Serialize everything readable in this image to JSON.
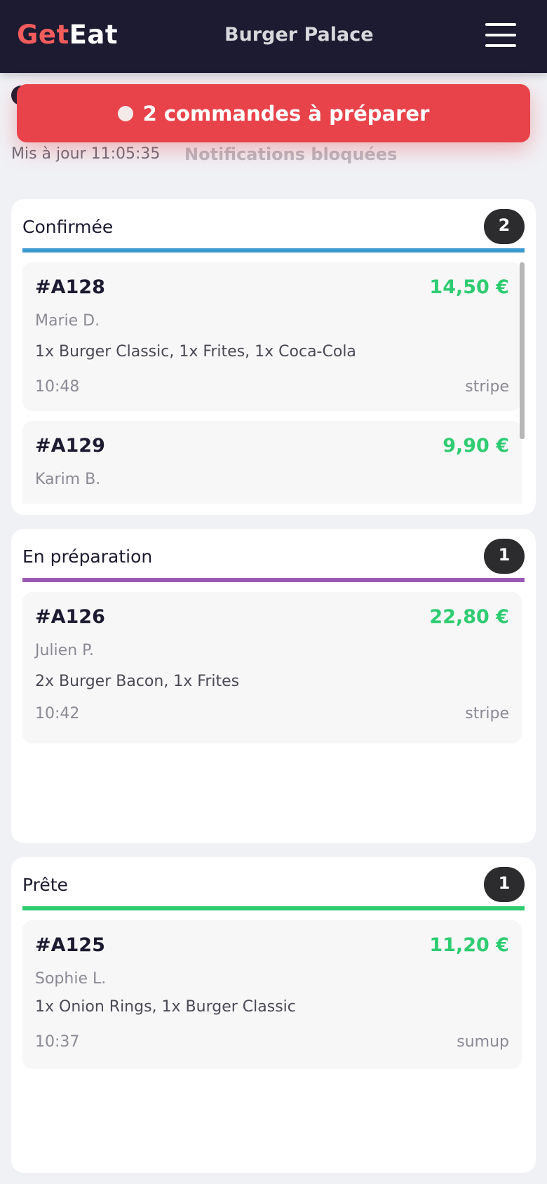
{
  "header": {
    "logo_part1": "Get",
    "logo_part2": "Eat",
    "restaurant": "Burger Palace",
    "menu_icon": "hamburger-menu-icon"
  },
  "alert": {
    "text": "2 commandes à préparer"
  },
  "status": {
    "updated": "Mis à jour 11:05:35",
    "notifications": "Notifications bloquées"
  },
  "colors": {
    "confirmed": "#3d9ad1",
    "preparing": "#9b59b6",
    "ready": "#2ecc71",
    "alert": "#e8434a",
    "price": "#2ecc71"
  },
  "columns": [
    {
      "title": "Confirmée",
      "count": "2",
      "orders": [
        {
          "id": "#A128",
          "price": "14,50 €",
          "customer": "Marie D.",
          "items": "1x Burger Classic, 1x Frites, 1x Coca-Cola",
          "time": "10:48",
          "payment": "stripe"
        },
        {
          "id": "#A129",
          "price": "9,90 €",
          "customer": "Karim B.",
          "items": "",
          "time": "",
          "payment": ""
        }
      ]
    },
    {
      "title": "En préparation",
      "count": "1",
      "orders": [
        {
          "id": "#A126",
          "price": "22,80 €",
          "customer": "Julien P.",
          "items": "2x Burger Bacon, 1x Frites",
          "time": "10:42",
          "payment": "stripe"
        }
      ]
    },
    {
      "title": "Prête",
      "count": "1",
      "orders": [
        {
          "id": "#A125",
          "price": "11,20 €",
          "customer": "Sophie L.",
          "items": "1x Onion Rings, 1x Burger Classic",
          "time": "10:37",
          "payment": "sumup"
        }
      ]
    }
  ]
}
